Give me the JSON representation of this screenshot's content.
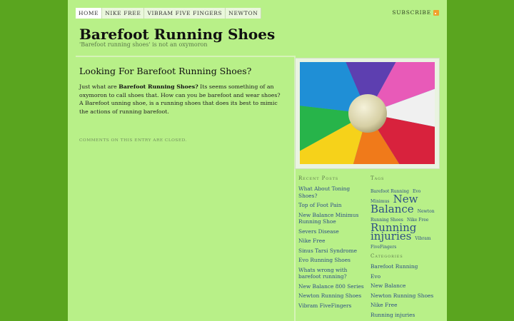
{
  "nav": {
    "items": [
      "Home",
      "Nike Free",
      "Vibram Five Fingers",
      "Newton"
    ],
    "subscribe": "Subscribe"
  },
  "site": {
    "title": "Barefoot Running Shoes",
    "description": "'Barefoot running shoes' is not an oxymoron"
  },
  "post": {
    "title": "Looking For Barefoot Running Shoes?",
    "lead_prefix": "Just what are ",
    "lead_bold": "Barefoot Running Shoes?",
    "body": " Its seems something of an oxymoron to call shoes that. How can you be barefoot and wear shoes? A Barefoot unning shoe, is a running shoes that does its best to mimic the actions of running barefoot.",
    "meta": "Comments on this entry are closed."
  },
  "recent_posts": {
    "title": "Recent Posts",
    "items": [
      "What About Toning Shoes?",
      "Top of Foot Pain",
      "New Balance Minimus Running Shoe",
      "Severs Disease",
      "Nike Free",
      "Sinus Tarsi Syndrome",
      "Evo Running Shoes",
      "Whats wrong with barefoot running?",
      "New Balance 800 Series",
      "Newton Running Shoes",
      "Vibram FiveFingers"
    ]
  },
  "tags": {
    "title": "Tags",
    "items": [
      {
        "label": "Barefoot Running",
        "size": "small"
      },
      {
        "label": "Evo",
        "size": "small"
      },
      {
        "label": "Minimus",
        "size": "small"
      },
      {
        "label": "New Balance",
        "size": "big"
      },
      {
        "label": "Newton Running Shoes",
        "size": "small"
      },
      {
        "label": "Nike Free",
        "size": "small"
      },
      {
        "label": "Running injuries",
        "size": "big"
      },
      {
        "label": "Vibram FiveFingers",
        "size": "small"
      }
    ]
  },
  "categories": {
    "title": "Categories",
    "items": [
      "Barefoot Running",
      "Evo",
      "New Balance",
      "Newton Running Shoes",
      "Nike Free",
      "Running injuries"
    ]
  },
  "colors": {
    "background": "#5aa51f",
    "page": "#b8f088",
    "link": "#2d4f86"
  }
}
